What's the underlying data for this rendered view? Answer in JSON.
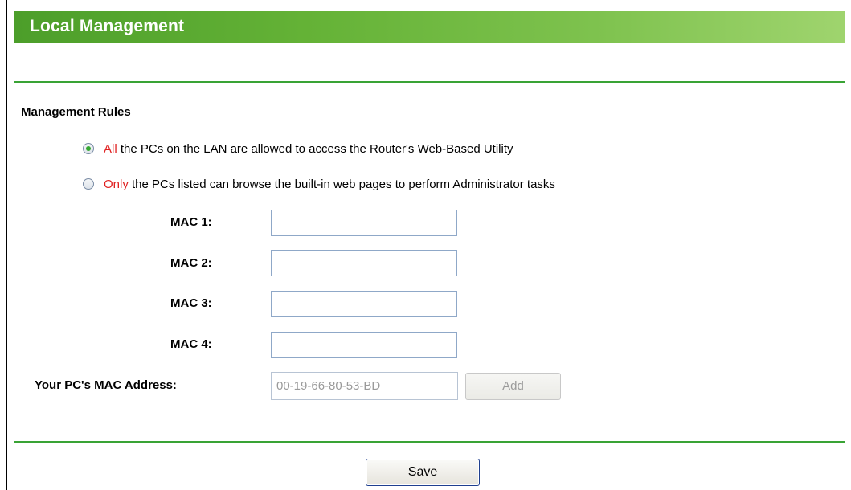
{
  "page": {
    "title": "Local Management"
  },
  "rules": {
    "section_title": "Management Rules",
    "option_all": {
      "highlight": "All",
      "text": " the PCs on the LAN are allowed to access the Router's Web-Based Utility",
      "checked": true
    },
    "option_only": {
      "highlight": "Only",
      "text": " the PCs listed can browse the built-in web pages to perform Administrator tasks",
      "checked": false
    }
  },
  "mac_fields": [
    {
      "label": "MAC 1:",
      "value": ""
    },
    {
      "label": "MAC 2:",
      "value": ""
    },
    {
      "label": "MAC 3:",
      "value": ""
    },
    {
      "label": "MAC 4:",
      "value": ""
    }
  ],
  "your_mac": {
    "label": "Your PC's MAC Address:",
    "value": "00-19-66-80-53-BD",
    "add_label": "Add"
  },
  "actions": {
    "save_label": "Save"
  },
  "colors": {
    "header_green": "#64b236",
    "divider_green": "#39a335",
    "highlight_red": "#e02020",
    "radio_dot": "#35a831"
  }
}
